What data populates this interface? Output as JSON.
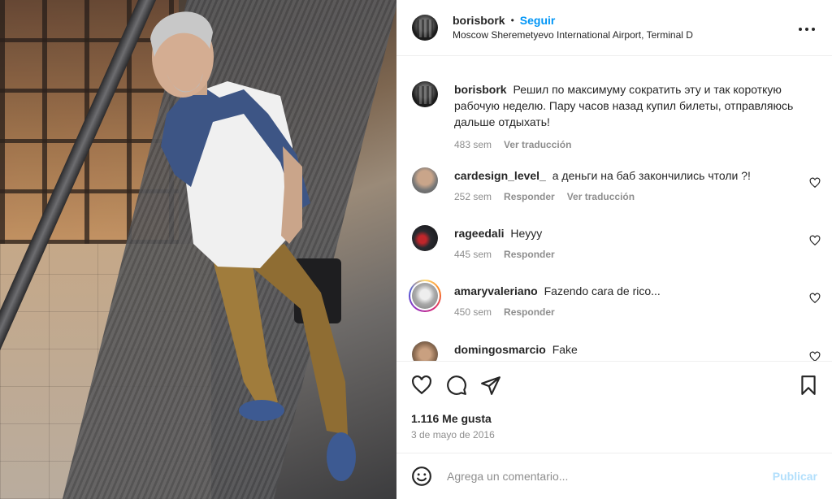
{
  "post": {
    "username": "borisbork",
    "separator": "•",
    "follow_label": "Seguir",
    "location": "Moscow Sheremetyevo International Airport, Terminal D",
    "more_icon": "more-horizontal-icon"
  },
  "caption": {
    "username": "borisbork",
    "text": "Решил по максимуму сократить эту и так короткую рабочую неделю. Пару часов назад купил билеты, отправляюсь дальше отдыхать!",
    "time": "483 sem",
    "translate_label": "Ver traducción"
  },
  "comments": [
    {
      "username": "cardesign_level_",
      "text": "а деньги на баб закончились чтоли ?!",
      "time": "252 sem",
      "reply_label": "Responder",
      "translate_label": "Ver traducción"
    },
    {
      "username": "rageedali",
      "text": "Heyyy",
      "time": "445 sem",
      "reply_label": "Responder"
    },
    {
      "username": "amaryvaleriano",
      "text": "Fazendo cara de rico...",
      "time": "450 sem",
      "reply_label": "Responder"
    },
    {
      "username": "domingosmarcio",
      "text": "Fake",
      "time": "",
      "reply_label": ""
    }
  ],
  "actions": {
    "like_icon": "heart-icon",
    "comment_icon": "comment-icon",
    "share_icon": "send-icon",
    "save_icon": "bookmark-icon",
    "likes_text": "1.116 Me gusta",
    "date_text": "3 de mayo de 2016"
  },
  "composer": {
    "emoji_icon": "emoji-icon",
    "placeholder": "Agrega un comentario...",
    "publish_label": "Publicar"
  },
  "colors": {
    "follow_blue": "#0095f6",
    "publish_disabled": "#b2dffc",
    "meta_gray": "#8e8e8e",
    "text": "#262626"
  }
}
